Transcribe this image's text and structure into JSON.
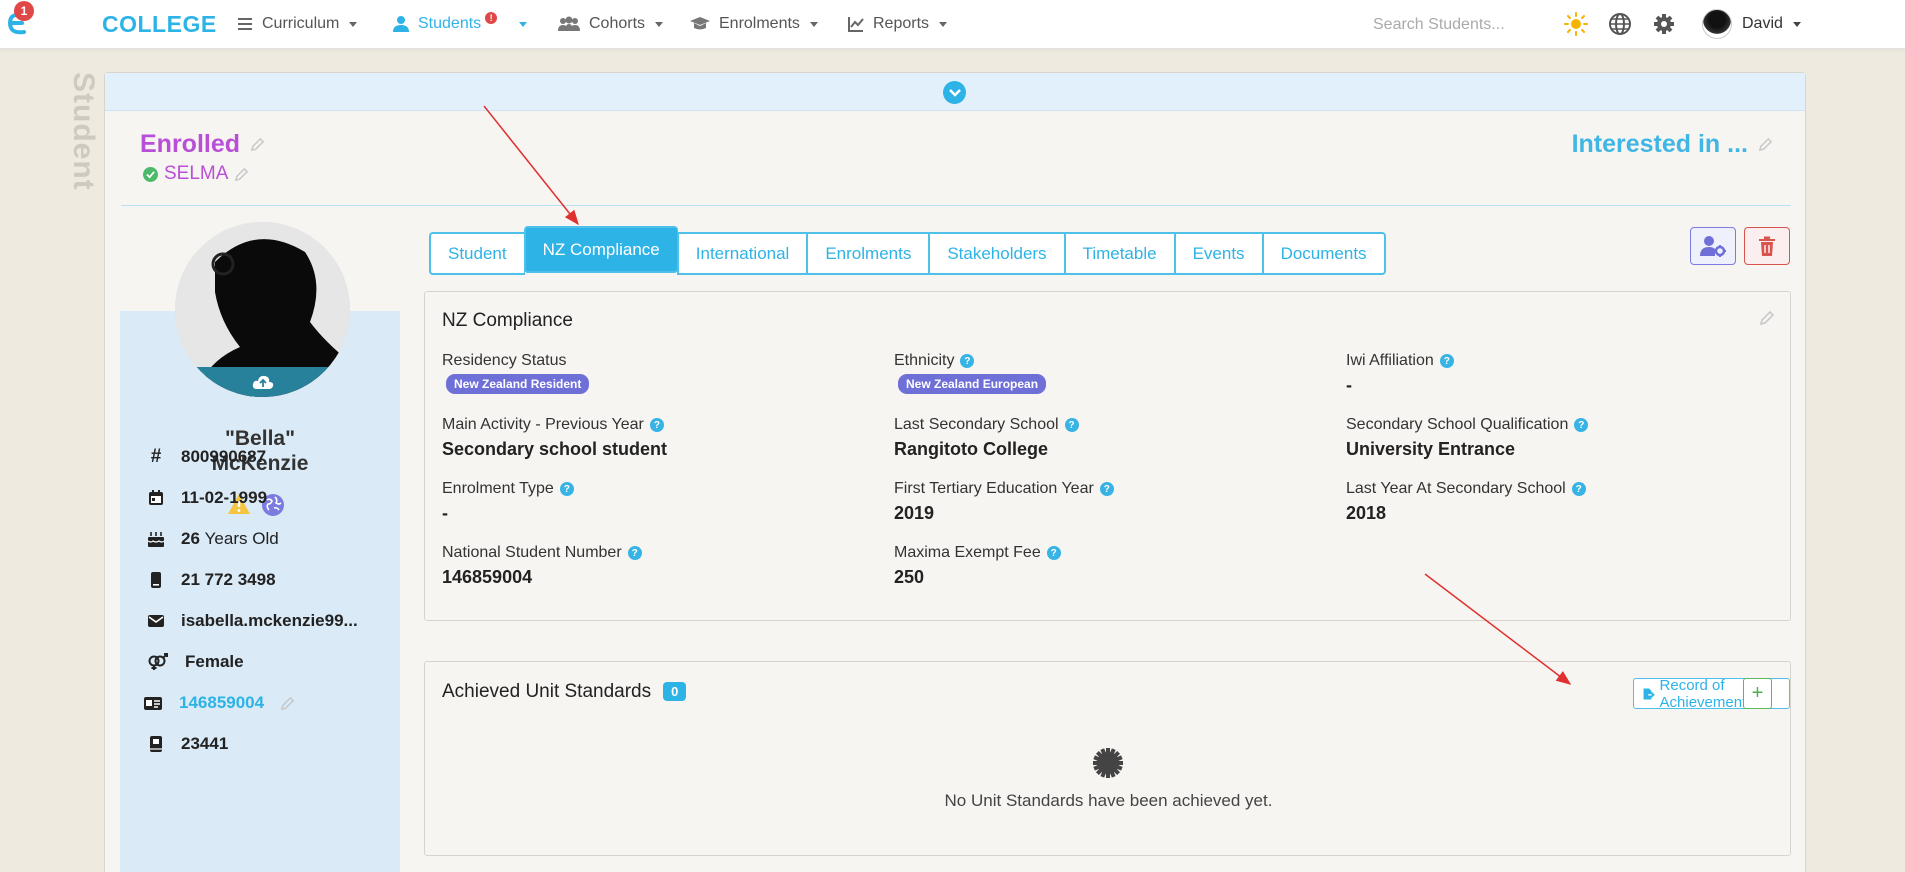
{
  "nav": {
    "brand": "COLLEGE",
    "logo_badge": "1",
    "items": [
      {
        "label": "Curriculum",
        "icon": "list-icon"
      },
      {
        "label": "Students",
        "icon": "user-icon",
        "alert": "!"
      },
      {
        "label": "Cohorts",
        "icon": "users-icon"
      },
      {
        "label": "Enrolments",
        "icon": "graduation-cap-icon"
      },
      {
        "label": "Reports",
        "icon": "line-chart-icon"
      }
    ],
    "search_placeholder": "Search Students...",
    "user_name": "David"
  },
  "watermark": "Student",
  "status": {
    "title": "Enrolled",
    "sub": "SELMA",
    "interested": "Interested in ..."
  },
  "profile": {
    "nick": "\"Bella\"",
    "surname": "McKenzie",
    "student_id": "800990687",
    "dob": "11-02-1999",
    "age_num": "26",
    "age_suffix": "Years Old",
    "phone": "21 772 3498",
    "email": "isabella.mckenzie99...",
    "gender": "Female",
    "nsn_link": "146859004",
    "book_no": "23441"
  },
  "tabs": [
    "Student",
    "NZ Compliance",
    "International",
    "Enrolments",
    "Stakeholders",
    "Timetable",
    "Events",
    "Documents"
  ],
  "compliance": {
    "title": "NZ Compliance",
    "fields": {
      "residency_label": "Residency Status",
      "residency_value": "New Zealand Resident",
      "ethnicity_label": "Ethnicity",
      "ethnicity_value": "New Zealand European",
      "iwi_label": "Iwi Affiliation",
      "iwi_value": "-",
      "main_activity_label": "Main Activity - Previous Year",
      "main_activity_value": "Secondary school student",
      "last_school_label": "Last Secondary School",
      "last_school_value": "Rangitoto College",
      "qualification_label": "Secondary School Qualification",
      "qualification_value": "University Entrance",
      "enrolment_type_label": "Enrolment Type",
      "enrolment_type_value": "-",
      "first_tertiary_label": "First Tertiary Education Year",
      "first_tertiary_value": "2019",
      "last_year_school_label": "Last Year At Secondary School",
      "last_year_school_value": "2018",
      "nsn_label": "National Student Number",
      "nsn_value": "146859004",
      "maxima_label": "Maxima Exempt Fee",
      "maxima_value": "250"
    }
  },
  "unit_standards": {
    "title": "Achieved Unit Standards",
    "count": "0",
    "record_button": "Record of Achievement",
    "add_button": "+",
    "empty_message": "No Unit Standards have been achieved yet."
  },
  "colors": {
    "accent": "#2eb3e6",
    "status_purple": "#b94fd6",
    "pill_purple": "#6f6fd8",
    "danger": "#d9534f",
    "success": "#5cb85c"
  }
}
